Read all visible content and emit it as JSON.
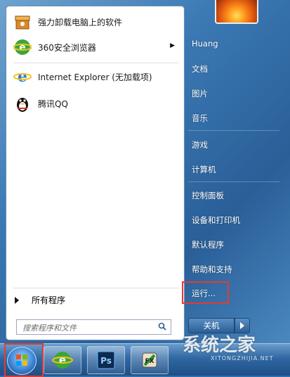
{
  "left_panel": {
    "programs": [
      {
        "label": "强力卸载电脑上的软件",
        "icon": "uninstall-box-icon",
        "has_submenu": false
      },
      {
        "label": "360安全浏览器",
        "icon": "360-browser-icon",
        "has_submenu": true
      },
      {
        "label": "Internet Explorer (无加载项)",
        "icon": "internet-explorer-icon",
        "has_submenu": false
      },
      {
        "label": "腾讯QQ",
        "icon": "qq-penguin-icon",
        "has_submenu": false
      }
    ],
    "all_programs_label": "所有程序",
    "search_placeholder": "搜索程序和文件"
  },
  "right_panel": {
    "user_name": "Huang",
    "items": [
      "文档",
      "图片",
      "音乐",
      "游戏",
      "计算机",
      "控制面板",
      "设备和打印机",
      "默认程序",
      "帮助和支持",
      "运行..."
    ],
    "shutdown_label": "关机"
  },
  "watermark": {
    "text": "系统之家",
    "sub": "XITONGZHIJIA.NET"
  },
  "colors": {
    "highlight_box": "#e23b35",
    "menu_accent": "#3b79b4"
  }
}
